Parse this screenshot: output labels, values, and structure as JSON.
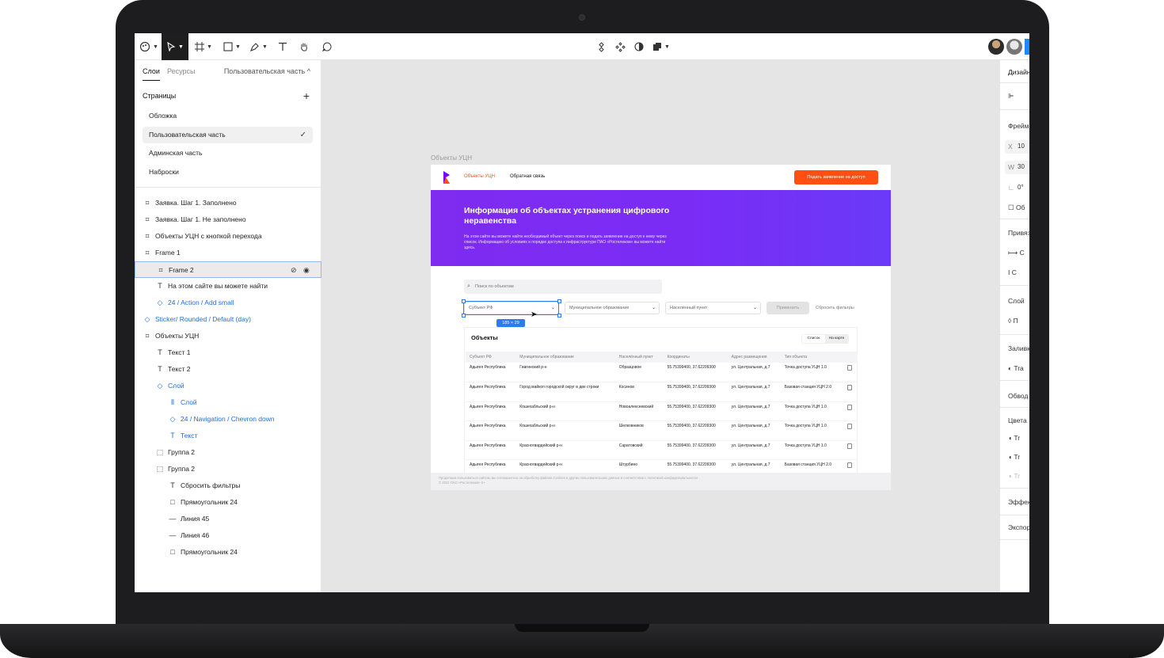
{
  "toolbar": {
    "tools": [
      "main-menu",
      "move",
      "frame",
      "rectangle",
      "pen",
      "text",
      "hand",
      "comment"
    ],
    "center_tools": [
      "component",
      "components",
      "mask",
      "boolean"
    ]
  },
  "left_panel": {
    "tabs": [
      "Слои",
      "Ресурсы"
    ],
    "current_page": "Пользовательская часть",
    "pages_header": "Страницы",
    "pages": [
      "Обложка",
      "Пользовательская часть",
      "Админская часть",
      "Наброски"
    ],
    "layers": [
      {
        "label": "Заявка. Шаг 1. Заполнено",
        "icon": "frame-icon"
      },
      {
        "label": "Заявка. Шаг 1. Не заполнено",
        "icon": "frame-icon"
      },
      {
        "label": "Объекты УЦН с кнопкой перехода",
        "icon": "frame-icon"
      },
      {
        "label": "Frame 1",
        "icon": "frame-icon"
      },
      {
        "label": "Frame 2",
        "icon": "frame-icon"
      },
      {
        "label": "На этом сайте вы можете найти",
        "icon": "text-icon"
      },
      {
        "label": "24 / Action / Add small",
        "icon": "component-icon"
      },
      {
        "label": "Sticker/ Rounded / Default (day)",
        "icon": "component-icon"
      },
      {
        "label": "Объекты УЦН",
        "icon": "frame-icon"
      },
      {
        "label": "Текст 1",
        "icon": "text-icon"
      },
      {
        "label": "Текст 2",
        "icon": "text-icon"
      },
      {
        "label": "Слой",
        "icon": "component-icon"
      },
      {
        "label": "Слой",
        "icon": "autolayout-icon"
      },
      {
        "label": "24 / Navigation / Chevron down",
        "icon": "component-icon"
      },
      {
        "label": "Текст",
        "icon": "text-icon"
      },
      {
        "label": "Группа 2",
        "icon": "group-icon"
      },
      {
        "label": "Группа 2",
        "icon": "group-icon"
      },
      {
        "label": "Сбросить фильтры",
        "icon": "text-icon"
      },
      {
        "label": "Прямоугольник 24",
        "icon": "rectangle-icon"
      },
      {
        "label": "Линия 45",
        "icon": "line-icon"
      },
      {
        "label": "Линия 46",
        "icon": "line-icon"
      },
      {
        "label": "Прямоугольник 24",
        "icon": "rectangle-icon"
      }
    ]
  },
  "canvas": {
    "frame_label": "Объекты УЦН",
    "site": {
      "nav_active": "Объекты УЦН",
      "nav_other": "Обратная связь",
      "cta": "Подать заявление на доступ",
      "hero_title": "Информация об объектах устранения цифрового неравенства",
      "hero_text": "На этом сайте вы можете найти необходимый объект через поиск и подать заявление на доступ к нему через список. Информацию об условиях и порядке доступа к инфраструктуре ПАО «Ростелеком» вы можете найти здесь.",
      "search_placeholder": "Поиск по объектам",
      "filters": [
        "Субъект РФ",
        "Муниципальное образование",
        "Населённый пункт"
      ],
      "apply": "Применить",
      "reset": "Сбросить фильтры",
      "selection_size": "185 × 29",
      "card_title": "Объекты",
      "toggle": [
        "Список",
        "На карте"
      ],
      "columns": [
        "Субъект РФ",
        "Муниципальное образование",
        "Населённый пункт",
        "Координаты",
        "Адрес размещения",
        "Тип объекта"
      ],
      "rows": [
        [
          "Адыгея Республика",
          "Гиагинский р-н",
          "Образцовое",
          "55.75399400, 37.62209300",
          "ул. Центральная, д.7",
          "Точка доступа УЦН 1.0"
        ],
        [
          "Адыгея Республика",
          "Город майкоп городской округ в две строки",
          "Косинов",
          "55.75399400, 37.62209300",
          "ул. Центральная, д.7",
          "Базовая станция УЦН 2.0"
        ],
        [
          "Адыгея Республика",
          "Кошехабльский р-н",
          "Новоалексеевский",
          "55.75399400, 37.62209300",
          "ул. Центральная, д.7",
          "Точка доступа УЦН 1.0"
        ],
        [
          "Адыгея Республика",
          "Кошехабльский р-н",
          "Шелковников",
          "55.75399400, 37.62209300",
          "ул. Центральная, д.7",
          "Точка доступа УЦН 1.0"
        ],
        [
          "Адыгея Республика",
          "Красногвардейский р-н",
          "Саратовский",
          "55.75399400, 37.62209300",
          "ул. Центральная, д.7",
          "Точка доступа УЦН 1.0"
        ],
        [
          "Адыгея Республика",
          "Красногвардейский р-н",
          "Штурбино",
          "55.75399400, 37.62209300",
          "ул. Центральная, д.7",
          "Базовая станция УЦН 2.0"
        ]
      ],
      "footer_line1": "Продолжая пользоваться сайтом, вы соглашаетесь на обработку файлов Cookies и других пользовательских данных в соответствии с политикой конфиденциальности",
      "footer_line2": "© 2022 ПАО «Ростелеком» 0+"
    }
  },
  "right_panel": {
    "tab": "Дизайн",
    "frame": "Фрейм",
    "x_label": "X",
    "x_value": "10",
    "w_label": "W",
    "w_value": "30",
    "rotation_value": "0°",
    "clip": "Об",
    "constraints": "Привяз",
    "constraint_h": "С",
    "constraint_v": "С",
    "layer": "Слой",
    "layer_mode": "П",
    "fill": "Заливк",
    "fill_value": "Tra",
    "stroke": "Обвод",
    "colors": "Цвета",
    "color_values": [
      "Tr",
      "Tr",
      "Tr"
    ],
    "effects": "Эффек",
    "export": "Экспор"
  },
  "colors": {
    "accent_orange": "#ff4f12",
    "hero_purple": "#7f2bf0",
    "selection_blue": "#2c7bf0",
    "component_blue": "#1f6ed8"
  }
}
